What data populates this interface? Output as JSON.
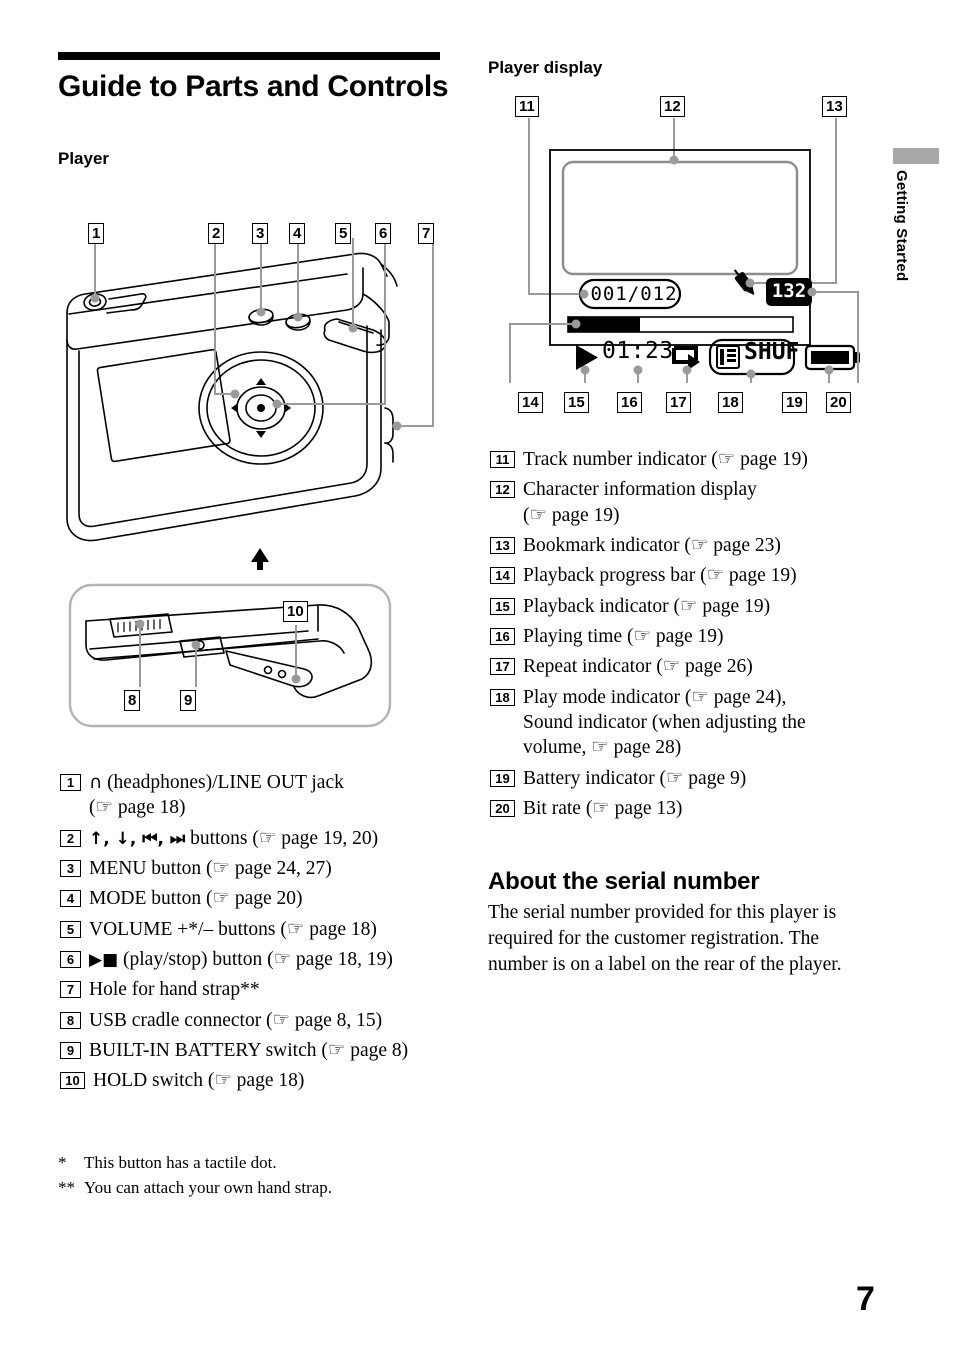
{
  "page": {
    "number": "7",
    "side_tab": "Getting Started"
  },
  "left": {
    "title": "Guide to Parts and Controls",
    "section_heading": "Player",
    "figure_numbers": [
      "1",
      "2",
      "3",
      "4",
      "5",
      "6",
      "7",
      "8",
      "9",
      "10"
    ],
    "items": [
      {
        "num": "1",
        "pre_glyph": "headphones-glyph",
        "text": " (headphones)/LINE OUT jack",
        "ref_lines": [
          "(☞ page 18)"
        ]
      },
      {
        "num": "2",
        "pre_glyph": "transport-glyphs",
        "text": " buttons (☞ page 19, 20)",
        "ref_lines": []
      },
      {
        "num": "3",
        "text": "MENU button (☞ page 24, 27)",
        "ref_lines": []
      },
      {
        "num": "4",
        "text": "MODE button (☞ page 20)",
        "ref_lines": []
      },
      {
        "num": "5",
        "text": "VOLUME +*/– buttons (☞ page 18)",
        "ref_lines": []
      },
      {
        "num": "6",
        "pre_glyph": "play-stop-glyph",
        "text": " (play/stop) button (☞ page 18, 19)",
        "ref_lines": []
      },
      {
        "num": "7",
        "text": "Hole for hand strap**",
        "ref_lines": []
      },
      {
        "num": "8",
        "text": "USB cradle connector (☞ page 8, 15)",
        "ref_lines": []
      },
      {
        "num": "9",
        "text": "BUILT-IN BATTERY switch (☞ page 8)",
        "ref_lines": []
      },
      {
        "num": "10",
        "text": "HOLD switch (☞ page 18)",
        "ref_lines": []
      }
    ],
    "glyphs": {
      "headphones": "∩",
      "transport": "↑, ↓, ⏮, ⏭",
      "play_stop": "▶■"
    },
    "footnotes": [
      {
        "mark": "*",
        "text": "This button has a tactile dot."
      },
      {
        "mark": "**",
        "text": "You can attach your own hand strap."
      }
    ]
  },
  "right": {
    "section_heading": "Player display",
    "display": {
      "track_number": "001/012",
      "bit_rate": "132",
      "playing_time": "01:23",
      "play_mode": "SHUF",
      "progress_percent": 32
    },
    "figure_numbers": [
      "11",
      "12",
      "13",
      "14",
      "15",
      "16",
      "17",
      "18",
      "19",
      "20"
    ],
    "items": [
      {
        "num": "11",
        "lines": [
          "Track number indicator (☞ page 19)"
        ]
      },
      {
        "num": "12",
        "lines": [
          "Character information display",
          "(☞ page 19)"
        ]
      },
      {
        "num": "13",
        "lines": [
          "Bookmark indicator (☞ page 23)"
        ]
      },
      {
        "num": "14",
        "lines": [
          "Playback progress bar (☞ page 19)"
        ]
      },
      {
        "num": "15",
        "lines": [
          "Playback indicator (☞ page 19)"
        ]
      },
      {
        "num": "16",
        "lines": [
          "Playing time (☞ page 19)"
        ]
      },
      {
        "num": "17",
        "lines": [
          "Repeat indicator (☞ page 26)"
        ]
      },
      {
        "num": "18",
        "lines": [
          "Play mode indicator (☞ page 24),",
          "Sound indicator (when adjusting the",
          "volume, ☞ page 28)"
        ]
      },
      {
        "num": "19",
        "lines": [
          "Battery indicator (☞ page 9)"
        ]
      },
      {
        "num": "20",
        "lines": [
          "Bit rate (☞ page 13)"
        ]
      }
    ],
    "serial": {
      "heading": "About the serial number",
      "body": "The serial number provided for this player is required for the customer registration. The number is on a label on the rear of the player."
    }
  }
}
